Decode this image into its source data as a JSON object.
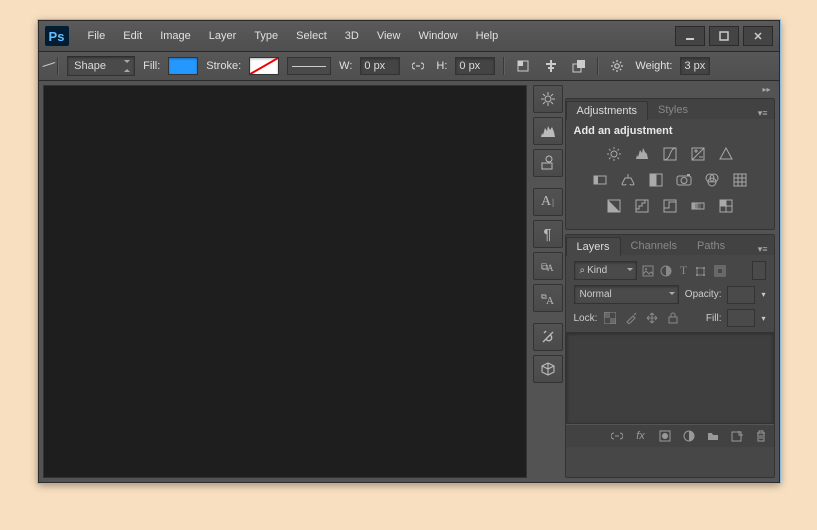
{
  "menu": [
    "File",
    "Edit",
    "Image",
    "Layer",
    "Type",
    "Select",
    "3D",
    "View",
    "Window",
    "Help"
  ],
  "options": {
    "shape_mode": "Shape",
    "fill_label": "Fill:",
    "stroke_label": "Stroke:",
    "w_label": "W:",
    "w_value": "0 px",
    "h_label": "H:",
    "h_value": "0 px",
    "weight_label": "Weight:",
    "weight_value": "3 px"
  },
  "adjustments": {
    "tab1": "Adjustments",
    "tab2": "Styles",
    "title": "Add an adjustment"
  },
  "layers": {
    "tab1": "Layers",
    "tab2": "Channels",
    "tab3": "Paths",
    "kind_icon": "⌕",
    "kind": "Kind",
    "blend": "Normal",
    "opacity_label": "Opacity:",
    "lock_label": "Lock:",
    "fill_label": "Fill:"
  }
}
